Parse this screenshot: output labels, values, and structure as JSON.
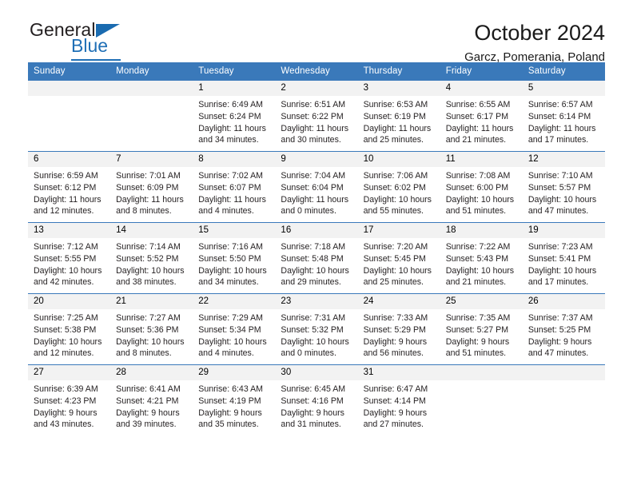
{
  "brand": {
    "name_top": "General",
    "name_bottom": "Blue",
    "accent_color": "#1f6fb6",
    "logo_icon": "triangle-flag-icon"
  },
  "header": {
    "title": "October 2024",
    "location": "Garcz, Pomerania, Poland"
  },
  "calendar": {
    "header_bg": "#3a79ba",
    "daynum_bg": "#f2f2f2",
    "weekday_headers": [
      "Sunday",
      "Monday",
      "Tuesday",
      "Wednesday",
      "Thursday",
      "Friday",
      "Saturday"
    ],
    "labels": {
      "sunrise": "Sunrise:",
      "sunset": "Sunset:",
      "daylight": "Daylight:"
    },
    "weeks": [
      [
        {
          "day": ""
        },
        {
          "day": ""
        },
        {
          "day": "1",
          "sunrise": "Sunrise: 6:49 AM",
          "sunset": "Sunset: 6:24 PM",
          "daylight": "Daylight: 11 hours and 34 minutes."
        },
        {
          "day": "2",
          "sunrise": "Sunrise: 6:51 AM",
          "sunset": "Sunset: 6:22 PM",
          "daylight": "Daylight: 11 hours and 30 minutes."
        },
        {
          "day": "3",
          "sunrise": "Sunrise: 6:53 AM",
          "sunset": "Sunset: 6:19 PM",
          "daylight": "Daylight: 11 hours and 25 minutes."
        },
        {
          "day": "4",
          "sunrise": "Sunrise: 6:55 AM",
          "sunset": "Sunset: 6:17 PM",
          "daylight": "Daylight: 11 hours and 21 minutes."
        },
        {
          "day": "5",
          "sunrise": "Sunrise: 6:57 AM",
          "sunset": "Sunset: 6:14 PM",
          "daylight": "Daylight: 11 hours and 17 minutes."
        }
      ],
      [
        {
          "day": "6",
          "sunrise": "Sunrise: 6:59 AM",
          "sunset": "Sunset: 6:12 PM",
          "daylight": "Daylight: 11 hours and 12 minutes."
        },
        {
          "day": "7",
          "sunrise": "Sunrise: 7:01 AM",
          "sunset": "Sunset: 6:09 PM",
          "daylight": "Daylight: 11 hours and 8 minutes."
        },
        {
          "day": "8",
          "sunrise": "Sunrise: 7:02 AM",
          "sunset": "Sunset: 6:07 PM",
          "daylight": "Daylight: 11 hours and 4 minutes."
        },
        {
          "day": "9",
          "sunrise": "Sunrise: 7:04 AM",
          "sunset": "Sunset: 6:04 PM",
          "daylight": "Daylight: 11 hours and 0 minutes."
        },
        {
          "day": "10",
          "sunrise": "Sunrise: 7:06 AM",
          "sunset": "Sunset: 6:02 PM",
          "daylight": "Daylight: 10 hours and 55 minutes."
        },
        {
          "day": "11",
          "sunrise": "Sunrise: 7:08 AM",
          "sunset": "Sunset: 6:00 PM",
          "daylight": "Daylight: 10 hours and 51 minutes."
        },
        {
          "day": "12",
          "sunrise": "Sunrise: 7:10 AM",
          "sunset": "Sunset: 5:57 PM",
          "daylight": "Daylight: 10 hours and 47 minutes."
        }
      ],
      [
        {
          "day": "13",
          "sunrise": "Sunrise: 7:12 AM",
          "sunset": "Sunset: 5:55 PM",
          "daylight": "Daylight: 10 hours and 42 minutes."
        },
        {
          "day": "14",
          "sunrise": "Sunrise: 7:14 AM",
          "sunset": "Sunset: 5:52 PM",
          "daylight": "Daylight: 10 hours and 38 minutes."
        },
        {
          "day": "15",
          "sunrise": "Sunrise: 7:16 AM",
          "sunset": "Sunset: 5:50 PM",
          "daylight": "Daylight: 10 hours and 34 minutes."
        },
        {
          "day": "16",
          "sunrise": "Sunrise: 7:18 AM",
          "sunset": "Sunset: 5:48 PM",
          "daylight": "Daylight: 10 hours and 29 minutes."
        },
        {
          "day": "17",
          "sunrise": "Sunrise: 7:20 AM",
          "sunset": "Sunset: 5:45 PM",
          "daylight": "Daylight: 10 hours and 25 minutes."
        },
        {
          "day": "18",
          "sunrise": "Sunrise: 7:22 AM",
          "sunset": "Sunset: 5:43 PM",
          "daylight": "Daylight: 10 hours and 21 minutes."
        },
        {
          "day": "19",
          "sunrise": "Sunrise: 7:23 AM",
          "sunset": "Sunset: 5:41 PM",
          "daylight": "Daylight: 10 hours and 17 minutes."
        }
      ],
      [
        {
          "day": "20",
          "sunrise": "Sunrise: 7:25 AM",
          "sunset": "Sunset: 5:38 PM",
          "daylight": "Daylight: 10 hours and 12 minutes."
        },
        {
          "day": "21",
          "sunrise": "Sunrise: 7:27 AM",
          "sunset": "Sunset: 5:36 PM",
          "daylight": "Daylight: 10 hours and 8 minutes."
        },
        {
          "day": "22",
          "sunrise": "Sunrise: 7:29 AM",
          "sunset": "Sunset: 5:34 PM",
          "daylight": "Daylight: 10 hours and 4 minutes."
        },
        {
          "day": "23",
          "sunrise": "Sunrise: 7:31 AM",
          "sunset": "Sunset: 5:32 PM",
          "daylight": "Daylight: 10 hours and 0 minutes."
        },
        {
          "day": "24",
          "sunrise": "Sunrise: 7:33 AM",
          "sunset": "Sunset: 5:29 PM",
          "daylight": "Daylight: 9 hours and 56 minutes."
        },
        {
          "day": "25",
          "sunrise": "Sunrise: 7:35 AM",
          "sunset": "Sunset: 5:27 PM",
          "daylight": "Daylight: 9 hours and 51 minutes."
        },
        {
          "day": "26",
          "sunrise": "Sunrise: 7:37 AM",
          "sunset": "Sunset: 5:25 PM",
          "daylight": "Daylight: 9 hours and 47 minutes."
        }
      ],
      [
        {
          "day": "27",
          "sunrise": "Sunrise: 6:39 AM",
          "sunset": "Sunset: 4:23 PM",
          "daylight": "Daylight: 9 hours and 43 minutes."
        },
        {
          "day": "28",
          "sunrise": "Sunrise: 6:41 AM",
          "sunset": "Sunset: 4:21 PM",
          "daylight": "Daylight: 9 hours and 39 minutes."
        },
        {
          "day": "29",
          "sunrise": "Sunrise: 6:43 AM",
          "sunset": "Sunset: 4:19 PM",
          "daylight": "Daylight: 9 hours and 35 minutes."
        },
        {
          "day": "30",
          "sunrise": "Sunrise: 6:45 AM",
          "sunset": "Sunset: 4:16 PM",
          "daylight": "Daylight: 9 hours and 31 minutes."
        },
        {
          "day": "31",
          "sunrise": "Sunrise: 6:47 AM",
          "sunset": "Sunset: 4:14 PM",
          "daylight": "Daylight: 9 hours and 27 minutes."
        },
        {
          "day": ""
        },
        {
          "day": ""
        }
      ]
    ]
  }
}
